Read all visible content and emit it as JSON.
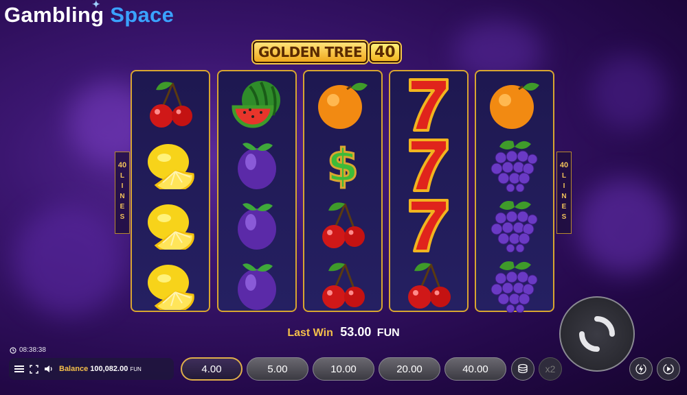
{
  "logo": {
    "part1": "Gambling",
    "part2": "Space"
  },
  "title": {
    "main": "GOLDEN TREE",
    "number": "40"
  },
  "lines_tab": {
    "count": "40",
    "word": [
      "L",
      "I",
      "N",
      "E",
      "S"
    ]
  },
  "reels": [
    [
      "cherry-icon",
      "lemon-icon",
      "lemon-icon",
      "lemon-icon"
    ],
    [
      "watermelon-icon",
      "plum-icon",
      "plum-icon",
      "plum-icon"
    ],
    [
      "orange-icon",
      "dollar-icon",
      "cherry-icon",
      "cherry-icon"
    ],
    [
      "seven-icon",
      "seven-icon",
      "seven-icon",
      "cherry-icon"
    ],
    [
      "orange-icon",
      "grapes-icon",
      "grapes-icon",
      "grapes-icon"
    ]
  ],
  "last_win": {
    "label": "Last Win",
    "amount": "53.00",
    "currency": "FUN"
  },
  "clock": "08:38:38",
  "balance": {
    "label": "Balance",
    "value": "100,082.00",
    "currency": "FUN"
  },
  "bets": [
    "4.00",
    "5.00",
    "10.00",
    "20.00",
    "40.00"
  ],
  "selected_bet": "4.00",
  "multiplier_label": "x2",
  "colors": {
    "accent": "#e0b04a",
    "brand_blue": "#3aa2ff",
    "background": "#3b1670"
  }
}
